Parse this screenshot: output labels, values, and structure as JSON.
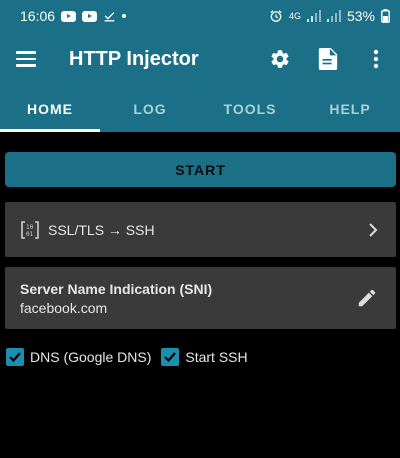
{
  "status_bar": {
    "time": "16:06",
    "battery": "53%",
    "network": "4G",
    "left_icons": [
      "youtube-icon",
      "youtube-icon",
      "download-done-icon",
      "dot-icon"
    ],
    "right_icons": [
      "alarm-icon",
      "network-4g-icon",
      "signal-icon",
      "signal-icon",
      "battery-icon"
    ]
  },
  "toolbar": {
    "title": "HTTP Injector",
    "icons": [
      "menu-icon",
      "settings-gear-icon",
      "file-icon",
      "more-vert-icon"
    ]
  },
  "tabs": [
    {
      "label": "HOME",
      "active": true
    },
    {
      "label": "LOG",
      "active": false
    },
    {
      "label": "TOOLS",
      "active": false
    },
    {
      "label": "HELP",
      "active": false
    }
  ],
  "start_button": {
    "label": "START"
  },
  "mode": {
    "label": "SSL/TLS → SSH",
    "icon": "binary-bracket-icon"
  },
  "sni": {
    "title": "Server Name Indication (SNI)",
    "value": "facebook.com",
    "icon": "edit-pencil-icon"
  },
  "options": [
    {
      "label": "DNS (Google DNS)",
      "checked": true
    },
    {
      "label": "Start SSH",
      "checked": true
    }
  ],
  "colors": {
    "primary": "#1b6f86",
    "tab_inactive": "#a9d1dc",
    "checkbox": "#1b8fb0",
    "card_bg": "#3a3a3a",
    "background": "#000000"
  }
}
